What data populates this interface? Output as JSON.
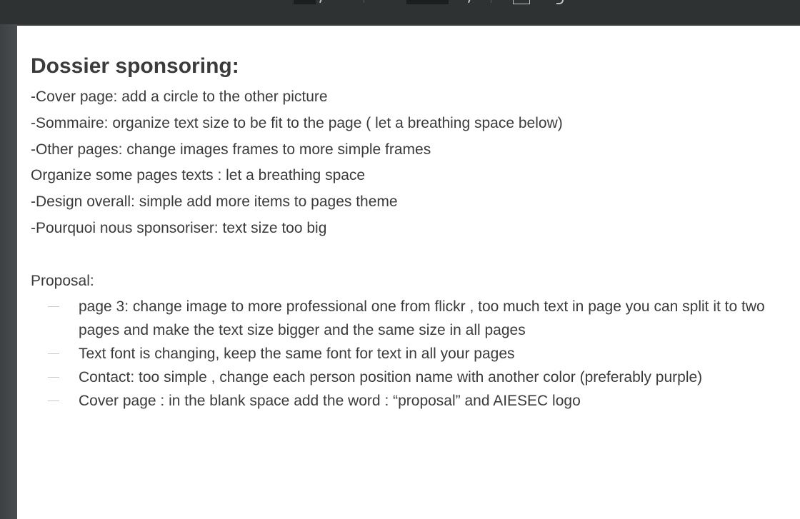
{
  "note": {
    "title": "Dossier sponsoring:",
    "lines": [
      "-Cover page: add a circle to the other picture",
      "-Sommaire: organize text size to be fit to the page ( let a breathing space below)",
      "-Other pages: change images frames to more simple frames",
      "Organize some pages texts : let a breathing space",
      "-Design overall: simple add more items to pages theme",
      "-Pourquoi nous sponsoriser: text size too big"
    ],
    "proposal_label": "Proposal:",
    "proposal_items": [
      "page 3: change image to more professional one from flickr , too much text in page you can split it to two pages and make the text size bigger and the same size in all pages",
      "Text font is changing, keep the same font for text in all your pages",
      "Contact: too simple , change each person position name with another color (preferably purple)",
      "Cover page : in the blank space add the word : “proposal” and AIESEC logo"
    ]
  },
  "colors": {
    "text": "#3b3b3b",
    "page_background": "#ffffff",
    "toolbar": "#2f3233",
    "bullet_dash": "#c9c9c9"
  }
}
